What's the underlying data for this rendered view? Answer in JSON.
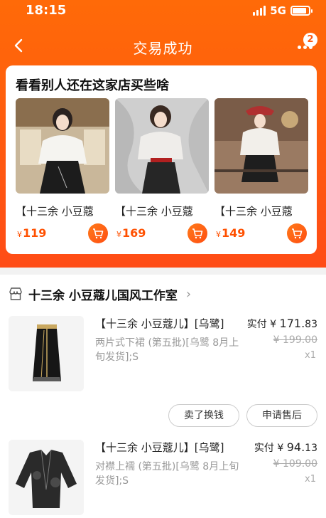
{
  "status_bar": {
    "time": "18:15",
    "network": "5G",
    "battery_percent": 85
  },
  "nav": {
    "title": "交易成功",
    "more_badge": "2"
  },
  "recommend": {
    "title": "看看别人还在这家店买些啥",
    "items": [
      {
        "name": "【十三余 小豆蔻",
        "currency": "¥",
        "price": "119"
      },
      {
        "name": "【十三余 小豆蔻",
        "currency": "¥",
        "price": "169"
      },
      {
        "name": "【十三余 小豆蔻",
        "currency": "¥",
        "price": "149"
      }
    ]
  },
  "shop": {
    "name": "十三余 小豆蔻儿国风工作室"
  },
  "order_items": [
    {
      "title": "【十三余 小豆蔻儿】[乌鹭]",
      "desc": "两片式下裙 (第五批)[乌鹭 8月上旬发货];S",
      "paid_label": "实付",
      "paid_currency": "¥",
      "paid_int": "171.",
      "paid_dec": "83",
      "orig_price": "¥ 199.00",
      "qty": "x1"
    },
    {
      "title": "【十三余 小豆蔻儿】[乌鹭]",
      "desc": "对襟上襦 (第五批)[乌鹭 8月上旬发货];S",
      "paid_label": "实付",
      "paid_currency": "¥",
      "paid_int": "94.",
      "paid_dec": "13",
      "orig_price": "¥ 109.00",
      "qty": "x1"
    }
  ],
  "actions": {
    "exchange": "卖了换钱",
    "after_sale": "申请售后"
  },
  "colors": {
    "accent": "#ff5a10",
    "price": "#ff5000"
  }
}
